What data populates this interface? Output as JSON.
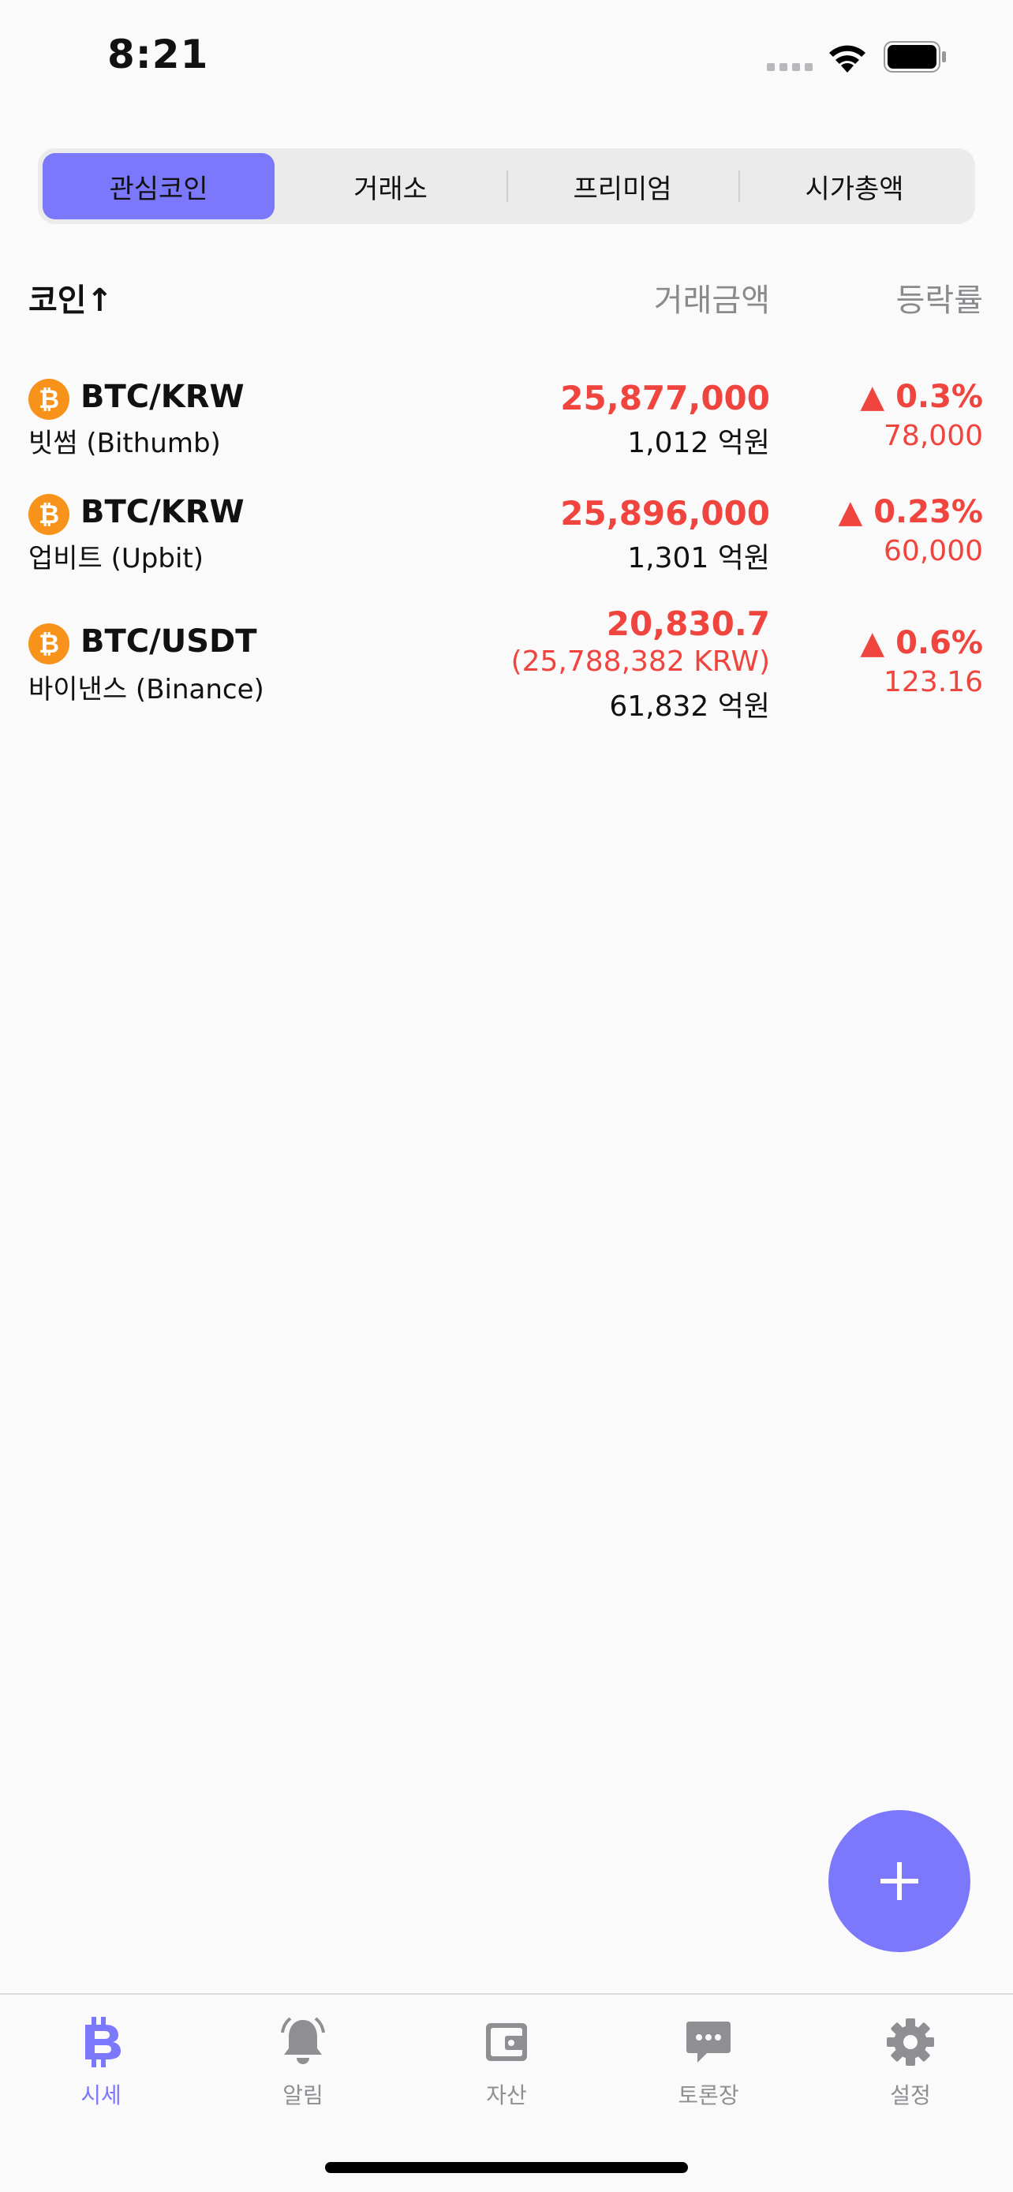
{
  "status_bar": {
    "time": "8:21"
  },
  "segment_tabs": [
    {
      "label": "관심코인",
      "active": true
    },
    {
      "label": "거래소",
      "active": false
    },
    {
      "label": "프리미엄",
      "active": false
    },
    {
      "label": "시가총액",
      "active": false
    }
  ],
  "columns": {
    "coin": "코인↑",
    "volume": "거래금액",
    "change": "등락률"
  },
  "rows": [
    {
      "coin_icon": "bitcoin-icon",
      "icon_glyph": "₿",
      "pair": "BTC/KRW",
      "exchange": "빗썸 (Bithumb)",
      "price": "25,877,000",
      "volume": "1,012 억원",
      "change_pct": "▲ 0.3%",
      "change_abs": "78,000"
    },
    {
      "coin_icon": "bitcoin-icon",
      "icon_glyph": "₿",
      "pair": "BTC/KRW",
      "exchange": "업비트 (Upbit)",
      "price": "25,896,000",
      "volume": "1,301 억원",
      "change_pct": "▲ 0.23%",
      "change_abs": "60,000"
    },
    {
      "coin_icon": "bitcoin-icon",
      "icon_glyph": "₿",
      "pair": "BTC/USDT",
      "exchange": "바이낸스 (Binance)",
      "price": "20,830.7",
      "price_krw": "(25,788,382 KRW)",
      "volume": "61,832 억원",
      "change_pct": "▲ 0.6%",
      "change_abs": "123.16"
    }
  ],
  "tab_bar": [
    {
      "label": "시세",
      "icon": "bitcoin-icon",
      "active": true
    },
    {
      "label": "알림",
      "icon": "bell-icon",
      "active": false
    },
    {
      "label": "자산",
      "icon": "wallet-icon",
      "active": false
    },
    {
      "label": "토론장",
      "icon": "chat-icon",
      "active": false
    },
    {
      "label": "설정",
      "icon": "gear-icon",
      "active": false
    }
  ],
  "colors": {
    "accent": "#7b78fb",
    "up": "#f0443e",
    "coin": "#f7931a",
    "inactive": "#8e8e93"
  }
}
